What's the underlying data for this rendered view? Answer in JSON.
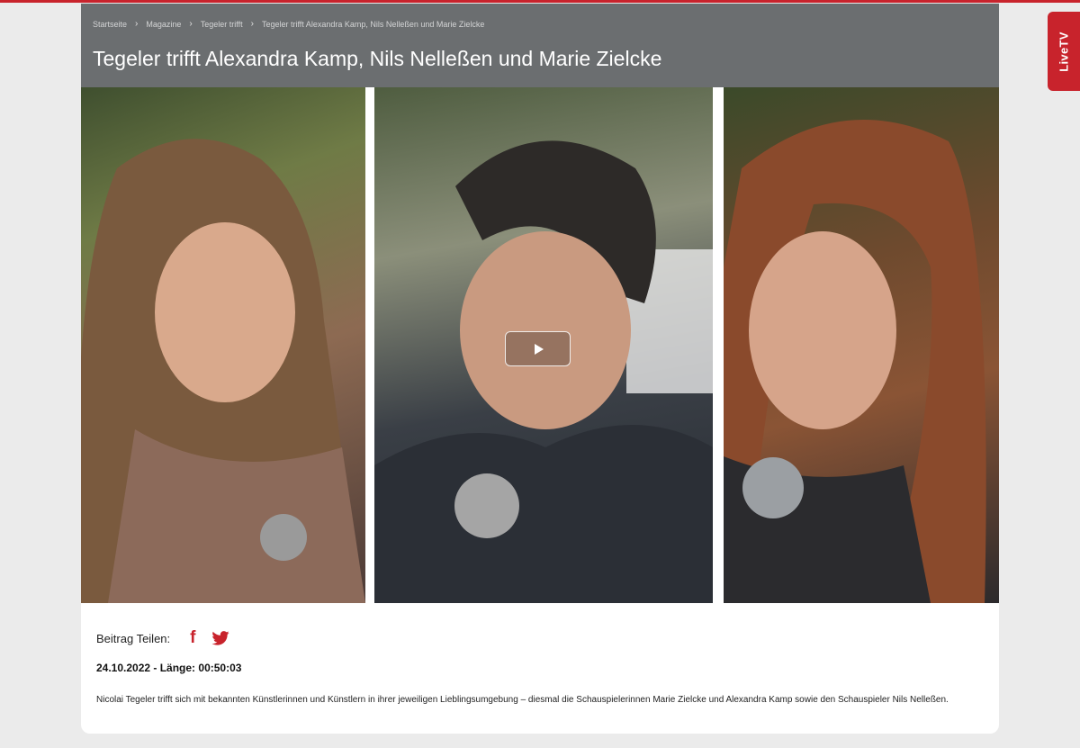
{
  "breadcrumb": [
    "Startseite",
    "Magazine",
    "Tegeler trifft",
    "Tegeler trifft Alexandra Kamp, Nils Nelleßen und Marie Zielcke"
  ],
  "breadcrumb_separator": "›",
  "title": "Tegeler trifft Alexandra Kamp, Nils Nelleßen und Marie Zielcke",
  "livetv_label": "LiveTV",
  "share": {
    "label": "Beitrag Teilen:",
    "facebook_glyph": "f",
    "icons": [
      "facebook-icon",
      "twitter-icon"
    ]
  },
  "meta": "24.10.2022 - Länge: 00:50:03",
  "description": "Nicolai Tegeler trifft sich mit bekannten Künstlerinnen und Künstlern in ihrer jeweiligen Lieblingsumgebung – diesmal die Schauspielerinnen Marie Zielcke und Alexandra Kamp sowie den Schauspieler Nils Nelleßen.",
  "colors": {
    "accent": "#c8232c",
    "header_bg": "#6b6e70",
    "page_bg": "#ebebeb"
  }
}
